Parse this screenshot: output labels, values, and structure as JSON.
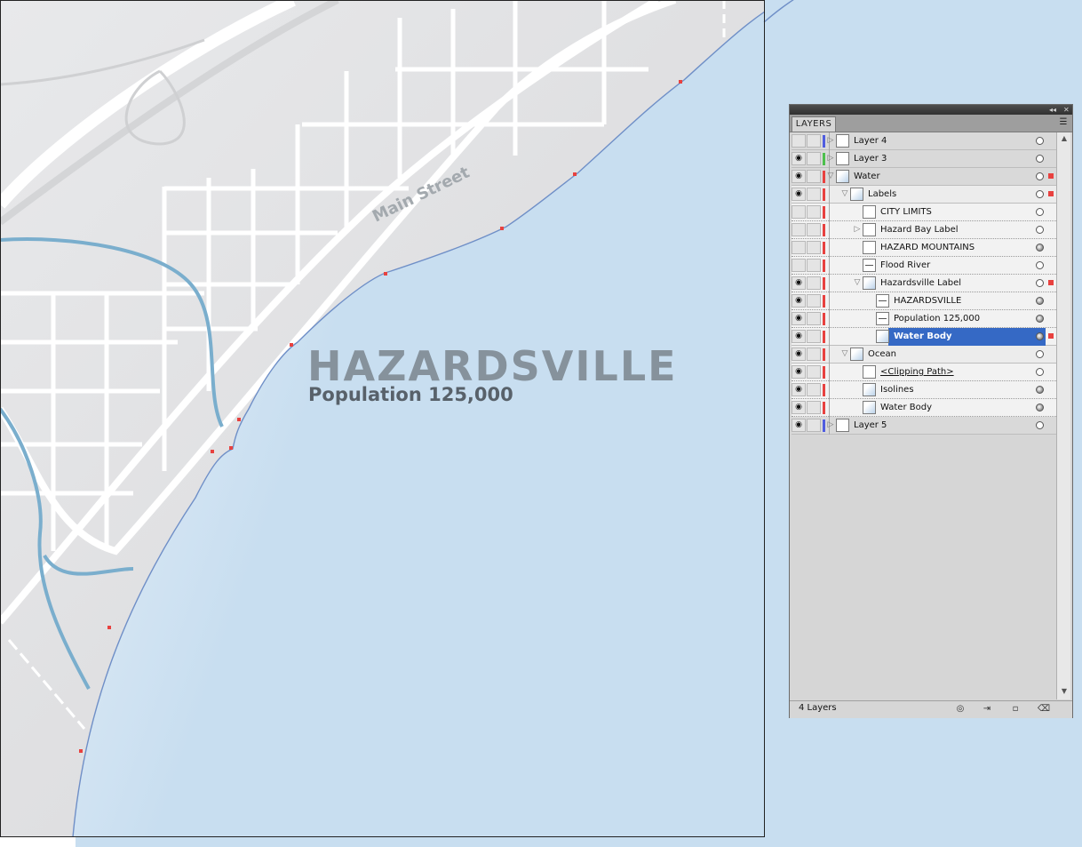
{
  "map": {
    "city_name": "HAZARDSVILLE",
    "population": "Population 125,000",
    "street_label": "Main Street"
  },
  "colors": {
    "land": "#e4e5e7",
    "water": "#c8def0",
    "road": "#ffffff",
    "river": "#7aaecd",
    "label_dark": "#58616a",
    "label_mid": "#86929c",
    "selection": "#3569c5",
    "layer_red": "#e8413f",
    "layer_blue": "#4f5ce0",
    "layer_green": "#4cc04c"
  },
  "layers_panel": {
    "tab": "LAYERS",
    "count_text": "4 Layers",
    "menu_icon": "panel-menu-icon",
    "collapse_icon": "collapse-icon",
    "close_icon": "close-icon",
    "footer_icons": [
      "make-clipping-mask-icon",
      "create-sublayer-icon",
      "create-new-layer-icon",
      "delete-icon"
    ],
    "rows": [
      {
        "label": "Layer 4",
        "visible": false,
        "color": "#4f5ce0",
        "level": 0,
        "disclosure": "collapsed",
        "target": "ring",
        "thumb": "blank"
      },
      {
        "label": "Layer 3",
        "visible": true,
        "color": "#4cc04c",
        "level": 0,
        "disclosure": "collapsed",
        "target": "ring",
        "thumb": "blank"
      },
      {
        "label": "Water",
        "visible": true,
        "color": "#e8413f",
        "level": 0,
        "disclosure": "expanded",
        "target": "ring",
        "thumb": "water",
        "sel": true
      },
      {
        "label": "Labels",
        "visible": true,
        "color": "#e8413f",
        "level": 1,
        "disclosure": "expanded",
        "target": "ring",
        "thumb": "water",
        "sel": true
      },
      {
        "label": "CITY LIMITS",
        "visible": false,
        "color": "#e8413f",
        "level": 2,
        "disclosure": "none",
        "target": "ring",
        "thumb": "blank"
      },
      {
        "label": "Hazard Bay Label",
        "visible": false,
        "color": "#e8413f",
        "level": 2,
        "disclosure": "collapsed",
        "target": "ring",
        "thumb": "blank"
      },
      {
        "label": "HAZARD   MOUNTAINS",
        "visible": false,
        "color": "#e8413f",
        "level": 2,
        "disclosure": "none",
        "target": "filled",
        "thumb": "blank"
      },
      {
        "label": "Flood River",
        "visible": false,
        "color": "#e8413f",
        "level": 2,
        "disclosure": "none",
        "target": "ring",
        "thumb": "line"
      },
      {
        "label": "Hazardsville Label",
        "visible": true,
        "color": "#e8413f",
        "level": 2,
        "disclosure": "expanded",
        "target": "ring",
        "thumb": "water",
        "sel": true
      },
      {
        "label": "HAZARDSVILLE",
        "visible": true,
        "color": "#e8413f",
        "level": 3,
        "disclosure": "none",
        "target": "filled",
        "thumb": "line"
      },
      {
        "label": "Population 125,000",
        "visible": true,
        "color": "#e8413f",
        "level": 3,
        "disclosure": "none",
        "target": "filled",
        "thumb": "line"
      },
      {
        "label": "Water Body",
        "visible": true,
        "color": "#e8413f",
        "level": 3,
        "disclosure": "none",
        "target": "filled",
        "thumb": "water",
        "selected": true,
        "sel": true
      },
      {
        "label": "Ocean",
        "visible": true,
        "color": "#e8413f",
        "level": 1,
        "disclosure": "expanded",
        "target": "ring",
        "thumb": "water"
      },
      {
        "label": "<Clipping Path>",
        "visible": true,
        "color": "#e8413f",
        "level": 2,
        "disclosure": "none",
        "target": "ring",
        "thumb": "blank",
        "clip": true
      },
      {
        "label": "Isolines",
        "visible": true,
        "color": "#e8413f",
        "level": 2,
        "disclosure": "none",
        "target": "filled",
        "thumb": "water"
      },
      {
        "label": "Water Body",
        "visible": true,
        "color": "#e8413f",
        "level": 2,
        "disclosure": "none",
        "target": "filled",
        "thumb": "water"
      },
      {
        "label": "Layer 5",
        "visible": true,
        "color": "#4f5ce0",
        "level": 0,
        "disclosure": "collapsed",
        "target": "ring",
        "thumb": "blank"
      }
    ]
  }
}
